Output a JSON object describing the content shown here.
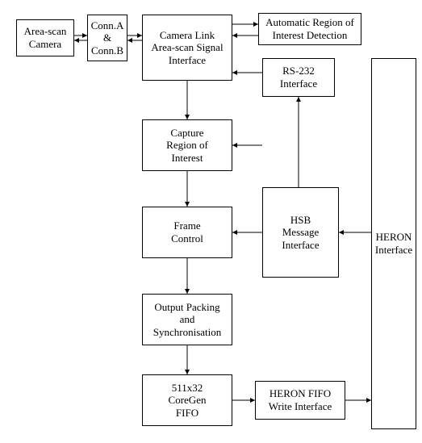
{
  "blocks": {
    "area_scan_camera": "Area-scan\nCamera",
    "conn": "Conn.A\n&\nConn.B",
    "camera_link": "Camera Link\nArea-scan Signal\nInterface",
    "auto_roi": "Automatic Region of\nInterest Detection",
    "rs232": "RS-232\nInterface",
    "capture_roi": "Capture\nRegion of\nInterest",
    "frame_control": "Frame\nControl",
    "hsb": "HSB\nMessage\nInterface",
    "heron_if": "HERON\nInterface",
    "output_pack": "Output Packing\nand\nSynchronisation",
    "coregen_fifo": "511x32\nCoreGen\nFIFO",
    "heron_fifo_write": "HERON FIFO\nWrite Interface"
  }
}
